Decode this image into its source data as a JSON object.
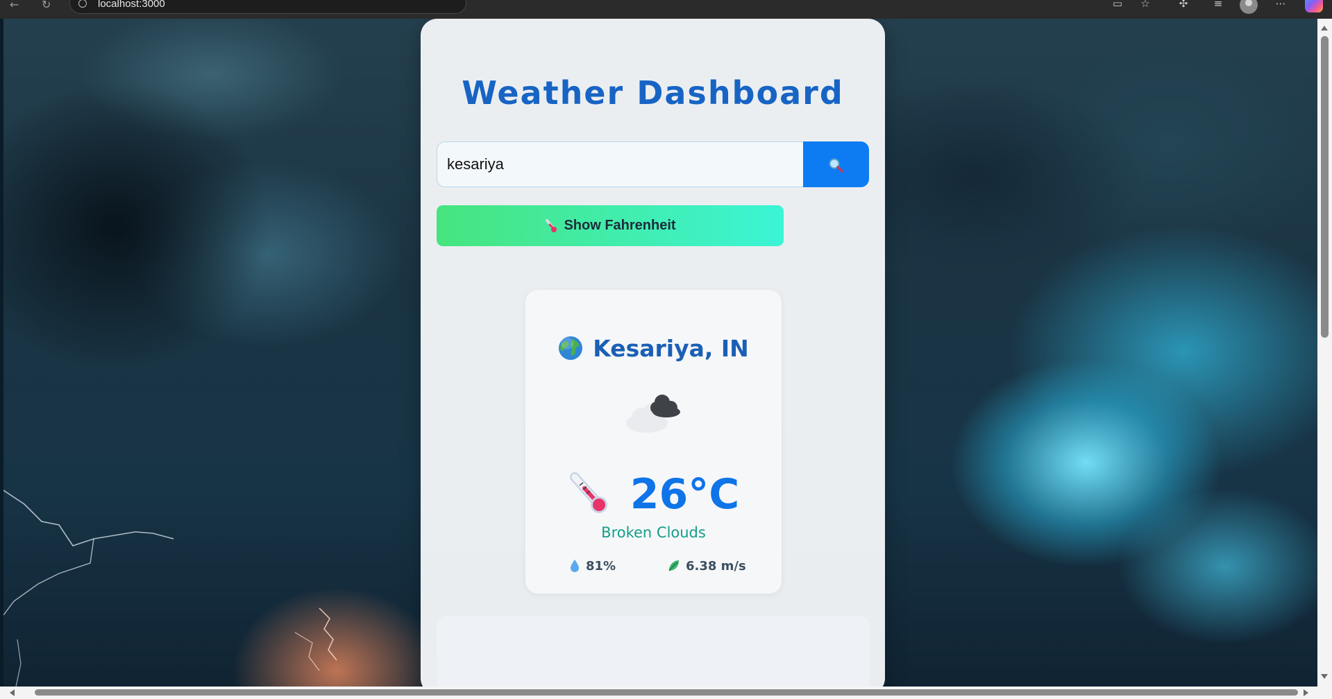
{
  "browser": {
    "url": "localhost:3000"
  },
  "app": {
    "title": "Weather Dashboard",
    "search": {
      "value": "kesariya",
      "button_icon": "magnifier-icon"
    },
    "unit_toggle": {
      "label": "Show Fahrenheit",
      "icon": "thermometer-icon"
    },
    "weather": {
      "location": "Kesariya, IN",
      "location_icon": "globe-icon",
      "condition_icon": "broken-clouds-icon",
      "temperature": "26°C",
      "description": "Broken Clouds",
      "humidity": "81%",
      "wind": "6.38 m/s"
    }
  },
  "colors": {
    "title": "#1764c4",
    "search_button": "#0d7cf2",
    "toggle_gradient_start": "#47e47e",
    "toggle_gradient_end": "#3cf5d6",
    "temperature": "#0e74e8",
    "description": "#129f88"
  }
}
